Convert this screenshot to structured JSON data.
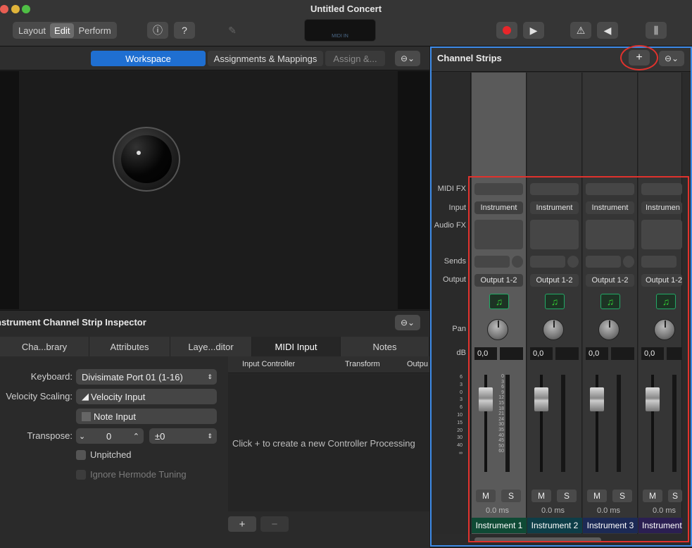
{
  "window": {
    "title": "Untitled Concert"
  },
  "toolbar": {
    "modes": [
      "Layout",
      "Edit",
      "Perform"
    ],
    "selected_mode": "Edit",
    "lcd_label": "MIDI IN"
  },
  "workspace_header": {
    "tabs": [
      "Workspace",
      "Assignments & Mappings",
      "Assign &..."
    ],
    "active_tab": "Workspace"
  },
  "inspector": {
    "title": "nstrument Channel Strip Inspector",
    "tabs": [
      "Cha...brary",
      "Attributes",
      "Laye...ditor",
      "MIDI Input",
      "Notes"
    ],
    "active_tab": "MIDI Input",
    "keyboard_label": "Keyboard:",
    "keyboard_value": "Divisimate Port 01 (1-16)",
    "velocity_label": "Velocity Scaling:",
    "velocity_input": "Velocity Input",
    "note_input": "Note Input",
    "transpose_label": "Transpose:",
    "transpose_value": "0",
    "transpose_range": "±0",
    "unpitched": "Unpitched",
    "ignore_tuning": "Ignore Hermode Tuning",
    "table_headers": [
      "Input Controller",
      "Transform",
      "Outpu"
    ],
    "empty_message": "Click + to create a new Controller Processing",
    "add": "+",
    "remove": "−"
  },
  "channel_strips": {
    "title": "Channel Strips",
    "add": "+",
    "row_labels": {
      "midi_fx": "MIDI FX",
      "input": "Input",
      "audio_fx": "Audio FX",
      "sends": "Sends",
      "output": "Output",
      "pan": "Pan",
      "db": "dB"
    },
    "scale": [
      "6",
      "3",
      "0",
      "3",
      "6",
      "10",
      "15",
      "20",
      "30",
      "40",
      "∞"
    ],
    "meter_scale": [
      "0",
      "3",
      "6",
      "9",
      "12",
      "15",
      "18",
      "21",
      "24",
      "30",
      "35",
      "40",
      "45",
      "50",
      "60"
    ],
    "strips": [
      {
        "name": "Instrument 1",
        "input": "Instrument",
        "output": "Output 1-2",
        "db": "0,0",
        "latency": "0.0 ms",
        "mute": "M",
        "solo": "S",
        "color": "#0f4a35"
      },
      {
        "name": "Instrument 2",
        "input": "Instrument",
        "output": "Output 1-2",
        "db": "0,0",
        "latency": "0.0 ms",
        "mute": "M",
        "solo": "S",
        "color": "#0e3e48"
      },
      {
        "name": "Instrument 3",
        "input": "Instrument",
        "output": "Output 1-2",
        "db": "0,0",
        "latency": "0.0 ms",
        "mute": "M",
        "solo": "S",
        "color": "#1c2a55"
      },
      {
        "name": "Instrument",
        "input": "Instrumen",
        "output": "Output 1-2",
        "db": "0,0",
        "latency": "0.0 ms",
        "mute": "M",
        "solo": "S",
        "color": "#2b1f52"
      }
    ]
  },
  "colors": {
    "accent_blue": "#1f6fd1",
    "highlight_red": "#e0322d",
    "record_red": "#e8262a"
  }
}
